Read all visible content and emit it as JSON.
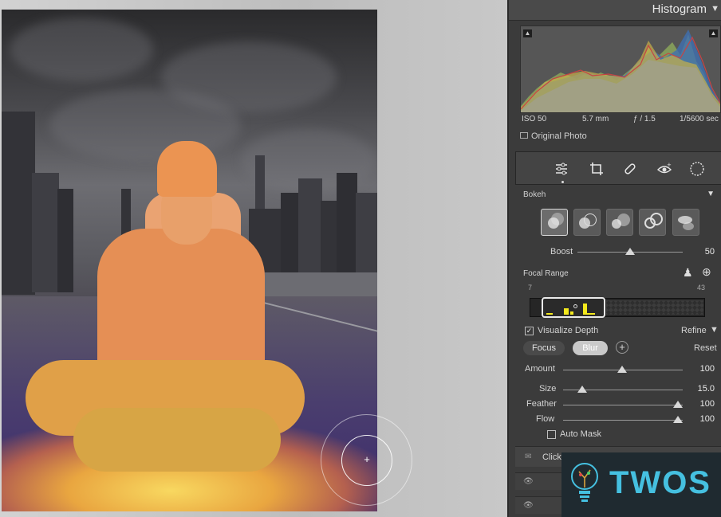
{
  "histogram": {
    "title": "Histogram",
    "iso": "ISO 50",
    "focal_length": "5.7 mm",
    "aperture": "ƒ / 1.5",
    "shutter": "1/5600 sec",
    "original_photo": "Original Photo"
  },
  "tools": [
    "sliders-icon",
    "crop-icon",
    "bandage-icon",
    "eye-icon",
    "circle-icon"
  ],
  "bokeh": {
    "label": "Bokeh",
    "boost_label": "Boost",
    "boost_value": "50",
    "boost_level": 0.5
  },
  "focal_range": {
    "label": "Focal Range",
    "min": "7",
    "max": "43"
  },
  "visualize": {
    "label": "Visualize Depth",
    "checked": true,
    "refine": "Refine"
  },
  "mode": {
    "focus": "Focus",
    "blur": "Blur",
    "reset": "Reset"
  },
  "brush": {
    "amount_label": "Amount",
    "amount_value": "100",
    "size_label": "Size",
    "size_value": "15.0",
    "feather_label": "Feather",
    "feather_value": "100",
    "flow_label": "Flow",
    "flow_value": "100",
    "auto_mask": "Auto Mask"
  },
  "help": {
    "text": "Click h"
  },
  "logo": {
    "text": "TWOS"
  },
  "colors": {
    "panel": "#3b3b3b",
    "focal_bars": "#f3e81c",
    "logo_text": "#45c0e0"
  }
}
